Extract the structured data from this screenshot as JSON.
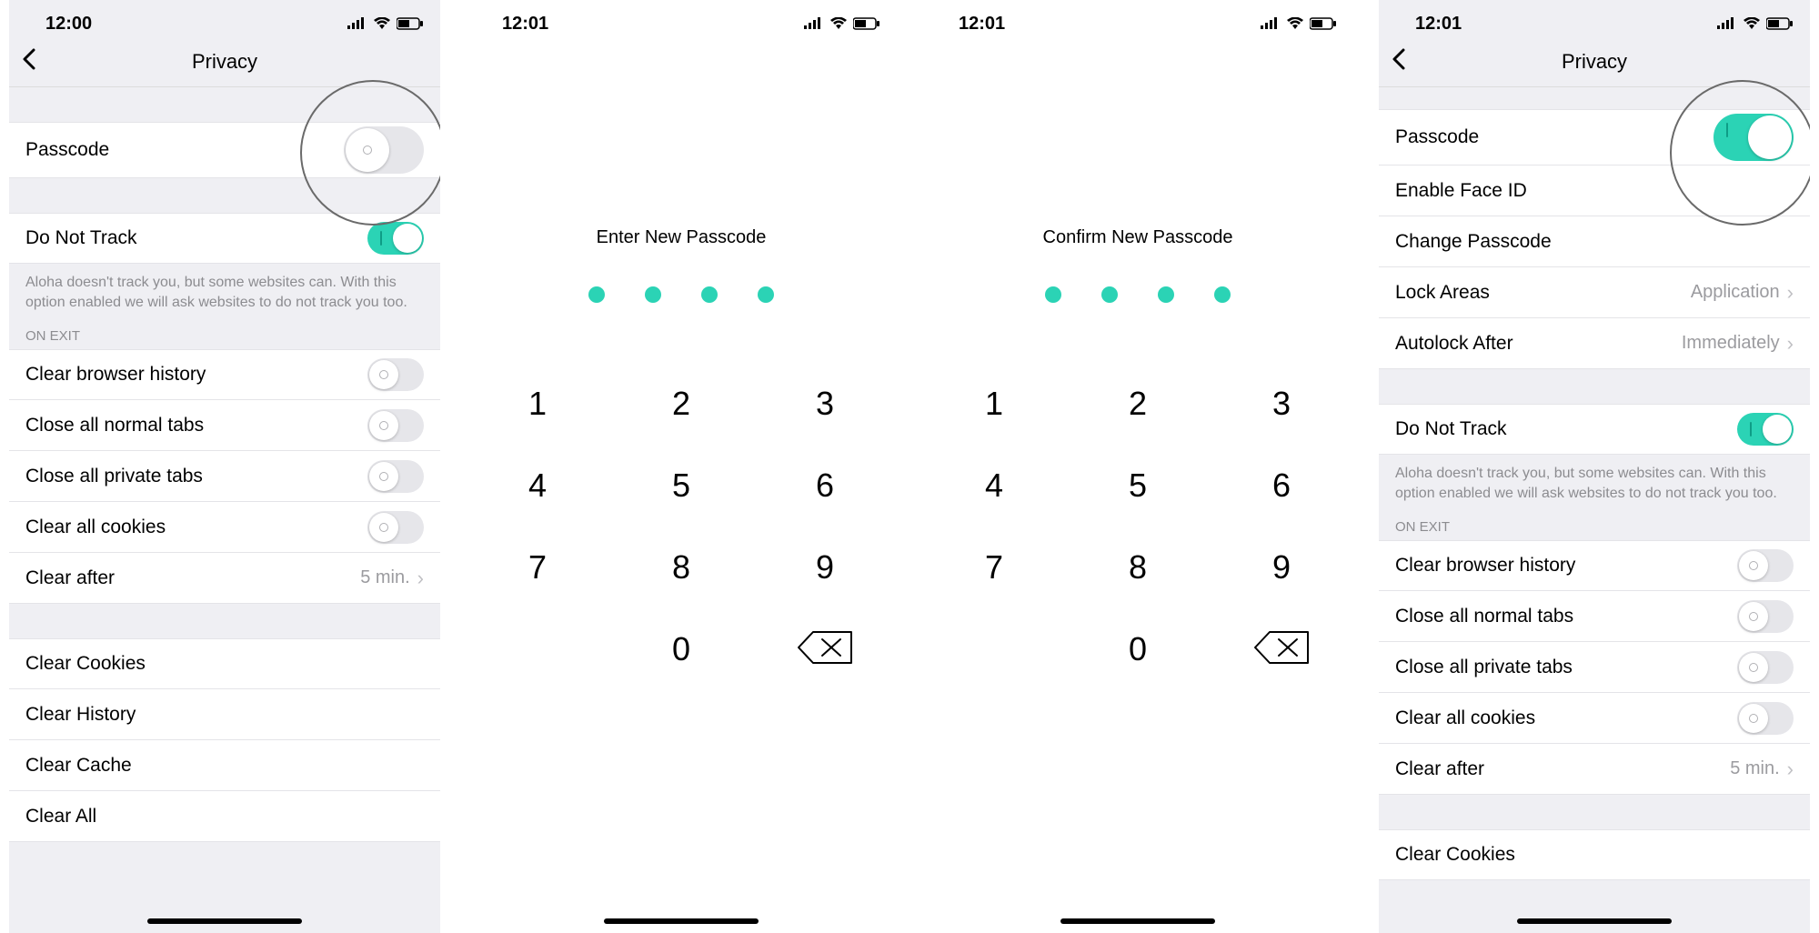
{
  "screens": [
    {
      "time": "12:00",
      "title": "Privacy",
      "passcode_label": "Passcode",
      "passcode_on": false,
      "dnt_label": "Do Not Track",
      "dnt_on": true,
      "dnt_note": "Aloha doesn't track you, but some websites can. With this option enabled we will ask websites to do not track you too.",
      "on_exit_header": "ON EXIT",
      "on_exit": [
        {
          "label": "Clear browser history",
          "on": false
        },
        {
          "label": "Close all normal tabs",
          "on": false
        },
        {
          "label": "Close all private tabs",
          "on": false
        },
        {
          "label": "Clear all cookies",
          "on": false
        }
      ],
      "clear_after_label": "Clear after",
      "clear_after_value": "5 min.",
      "actions": [
        "Clear Cookies",
        "Clear History",
        "Clear Cache",
        "Clear All"
      ]
    },
    {
      "time": "12:01",
      "prompt": "Enter New Passcode",
      "digits_entered": 4,
      "keypad": [
        "1",
        "2",
        "3",
        "4",
        "5",
        "6",
        "7",
        "8",
        "9",
        "",
        "0",
        "del"
      ]
    },
    {
      "time": "12:01",
      "prompt": "Confirm New Passcode",
      "digits_entered": 4,
      "keypad": [
        "1",
        "2",
        "3",
        "4",
        "5",
        "6",
        "7",
        "8",
        "9",
        "",
        "0",
        "del"
      ]
    },
    {
      "time": "12:01",
      "title": "Privacy",
      "passcode_label": "Passcode",
      "passcode_on": true,
      "passcode_rows": [
        {
          "label": "Enable Face ID"
        },
        {
          "label": "Change Passcode"
        },
        {
          "label": "Lock Areas",
          "value": "Application"
        },
        {
          "label": "Autolock After",
          "value": "Immediately"
        }
      ],
      "dnt_label": "Do Not Track",
      "dnt_on": true,
      "dnt_note": "Aloha doesn't track you, but some websites can. With this option enabled we will ask websites to do not track you too.",
      "on_exit_header": "ON EXIT",
      "on_exit": [
        {
          "label": "Clear browser history",
          "on": false
        },
        {
          "label": "Close all normal tabs",
          "on": false
        },
        {
          "label": "Close all private tabs",
          "on": false
        },
        {
          "label": "Clear all cookies",
          "on": false
        }
      ],
      "clear_after_label": "Clear after",
      "clear_after_value": "5 min.",
      "actions": [
        "Clear Cookies"
      ]
    }
  ]
}
